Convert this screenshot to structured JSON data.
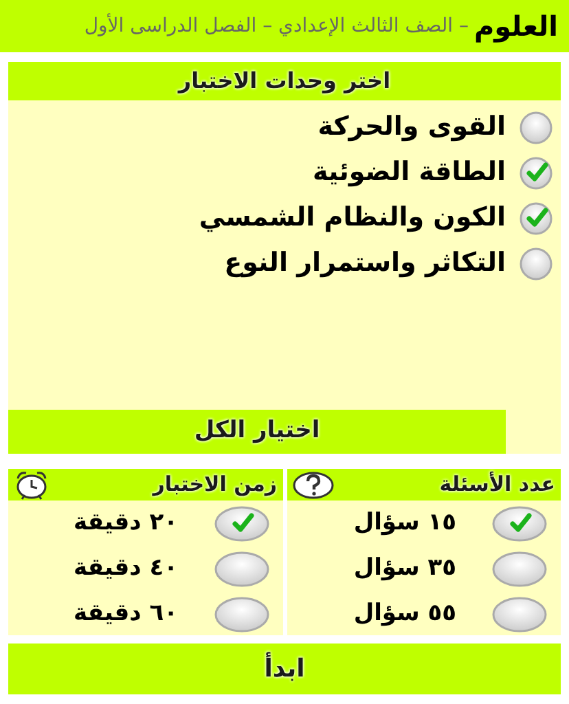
{
  "header": {
    "subject": "العلوم",
    "subtitle": "– الصف الثالث الإعدادي – الفصل الدراسى الأول"
  },
  "units": {
    "title": "اختر وحدات الاختبار",
    "items": [
      {
        "label": "القوى والحركة",
        "checked": false
      },
      {
        "label": "الطاقة الضوئية",
        "checked": true
      },
      {
        "label": "الكون والنظام الشمسي",
        "checked": true
      },
      {
        "label": "التكاثر واستمرار النوع",
        "checked": false
      }
    ],
    "select_all": "اختيار الكل"
  },
  "question_count": {
    "title": "عدد الأسئلة",
    "options": [
      {
        "label": "١٥ سؤال",
        "selected": true
      },
      {
        "label": "٣٥ سؤال",
        "selected": false
      },
      {
        "label": "٥٥ سؤال",
        "selected": false
      }
    ]
  },
  "test_time": {
    "title": "زمن الاختبار",
    "options": [
      {
        "label": "٢٠ دقيقة",
        "selected": true
      },
      {
        "label": "٤٠ دقيقة",
        "selected": false
      },
      {
        "label": "٦٠ دقيقة",
        "selected": false
      }
    ]
  },
  "start_button": "ابدأ"
}
